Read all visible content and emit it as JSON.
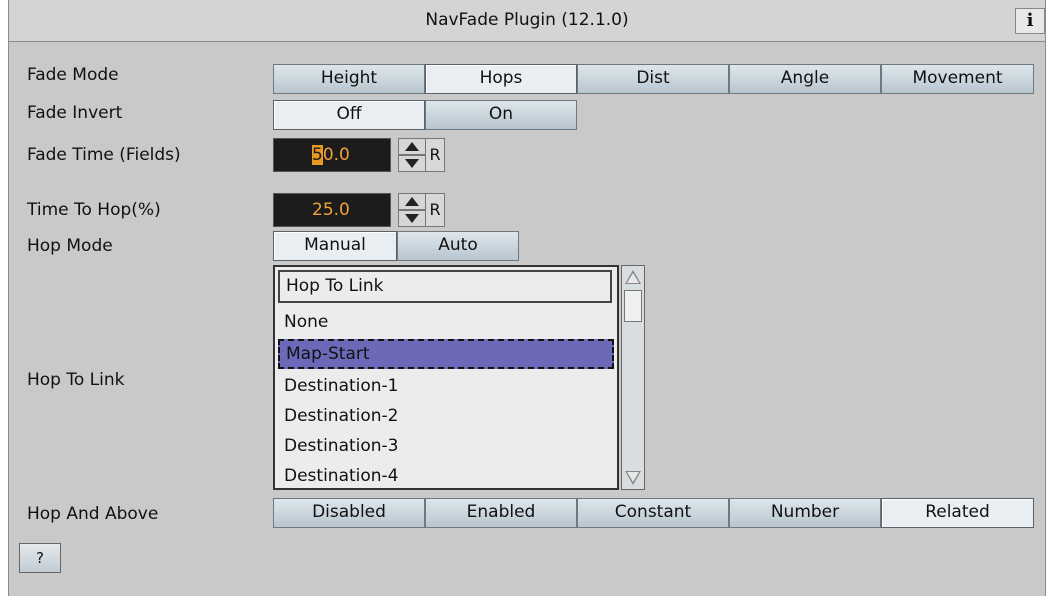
{
  "title": "NavFade Plugin (12.1.0)",
  "info_label": "i",
  "fade_mode": {
    "label": "Fade Mode",
    "options": [
      "Height",
      "Hops",
      "Dist",
      "Angle",
      "Movement"
    ],
    "selected": "Hops"
  },
  "fade_invert": {
    "label": "Fade Invert",
    "options": [
      "Off",
      "On"
    ],
    "selected": "Off"
  },
  "fade_time": {
    "label": "Fade Time (Fields)",
    "value_first": "5",
    "value_rest": "0.0",
    "reset_label": "R"
  },
  "time_to_hop": {
    "label": "Time To Hop(%)",
    "value": "25.0",
    "reset_label": "R"
  },
  "hop_mode": {
    "label": "Hop Mode",
    "options": [
      "Manual",
      "Auto"
    ],
    "selected": "Manual"
  },
  "hop_to_link": {
    "label": "Hop To Link",
    "header": "Hop To Link",
    "items": [
      "None",
      "Map-Start",
      "Destination-1",
      "Destination-2",
      "Destination-3",
      "Destination-4"
    ],
    "selected": "Map-Start"
  },
  "hop_and_above": {
    "label": "Hop And Above",
    "options": [
      "Disabled",
      "Enabled",
      "Constant",
      "Number",
      "Related"
    ],
    "selected": "Related"
  },
  "help_label": "?",
  "colors": {
    "selection": "#6b69b8",
    "value_text": "#f2a23a",
    "value_bg": "#1c1c1c"
  }
}
